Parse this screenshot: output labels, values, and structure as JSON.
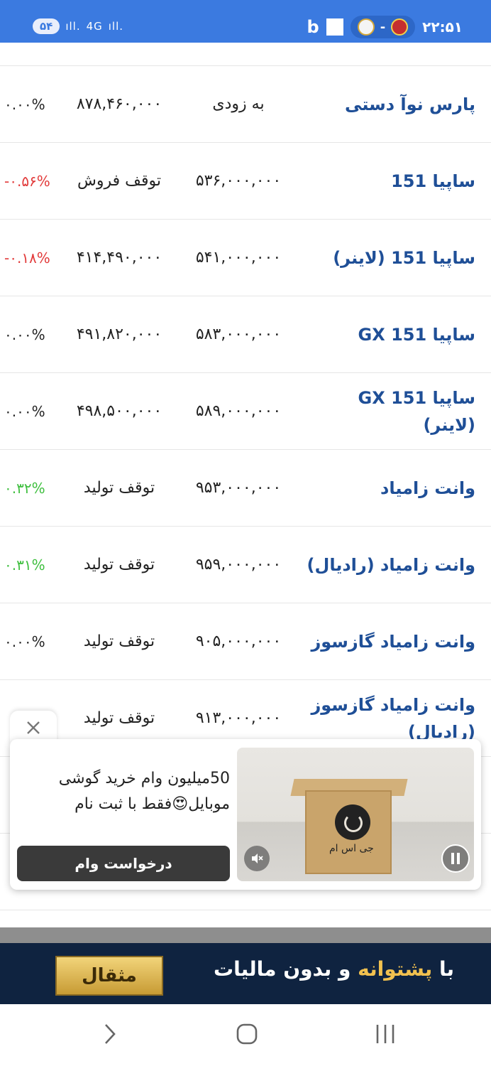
{
  "status_bar": {
    "time": "۲۲:۵۱",
    "battery_pill": "۵۴",
    "signal_1": "ıll.",
    "network": "4G",
    "signal_2": "ıll.",
    "score_separator": "-",
    "app_icon_letter": "b"
  },
  "rows": [
    {
      "name": "پارس نوآ دستی",
      "price": "به زودی",
      "prev": "۸۷۸,۴۶۰,۰۰۰",
      "change": "۰.۰۰%",
      "change_color": "neutral"
    },
    {
      "name": "ساپیا 151",
      "price": "۵۳۶,۰۰۰,۰۰۰",
      "prev": "توقف فروش",
      "change": "-۰.۵۶%",
      "change_color": "negative"
    },
    {
      "name": "ساپیا 151 (لاینر)",
      "price": "۵۴۱,۰۰۰,۰۰۰",
      "prev": "۴۱۴,۴۹۰,۰۰۰",
      "change": "-۰.۱۸%",
      "change_color": "negative"
    },
    {
      "name": "ساپیا GX 151",
      "price": "۵۸۳,۰۰۰,۰۰۰",
      "prev": "۴۹۱,۸۲۰,۰۰۰",
      "change": "۰.۰۰%",
      "change_color": "neutral"
    },
    {
      "name": "ساپیا GX 151 (لاینر)",
      "price": "۵۸۹,۰۰۰,۰۰۰",
      "prev": "۴۹۸,۵۰۰,۰۰۰",
      "change": "۰.۰۰%",
      "change_color": "neutral"
    },
    {
      "name": "وانت زامیاد",
      "price": "۹۵۳,۰۰۰,۰۰۰",
      "prev": "توقف تولید",
      "change": "۰.۳۲%",
      "change_color": "positive"
    },
    {
      "name": "وانت زامیاد (رادیال)",
      "price": "۹۵۹,۰۰۰,۰۰۰",
      "prev": "توقف تولید",
      "change": "۰.۳۱%",
      "change_color": "positive"
    },
    {
      "name": "وانت زامیاد گازسوز",
      "price": "۹۰۵,۰۰۰,۰۰۰",
      "prev": "توقف تولید",
      "change": "۰.۰۰%",
      "change_color": "neutral"
    },
    {
      "name": "وانت زامیاد گازسوز (رادیال)",
      "price": "۹۱۳,۰۰۰,۰۰۰",
      "prev": "توقف تولید",
      "change": "",
      "change_color": "neutral"
    }
  ],
  "ad": {
    "text": "50میلیون وام خرید گوشی موبایل😍فقط با ثبت نام",
    "cta": "درخواست وام",
    "brand_caption": "جی اس ام",
    "close_icon": "close-icon",
    "mute_icon": "mute-icon",
    "pause_icon": "pause-icon"
  },
  "banner": {
    "text_prefix": "با ",
    "text_highlight": "پشتوانه",
    "text_suffix": " و بدون مالیات",
    "button_label": "مثقال"
  },
  "colors": {
    "status_bar": "#3b7ae0",
    "name_text": "#1f4f97",
    "negative": "#e23b3b",
    "positive": "#3fbf3f",
    "banner_bg": "#0f2340",
    "banner_accent": "#f2c14f"
  }
}
